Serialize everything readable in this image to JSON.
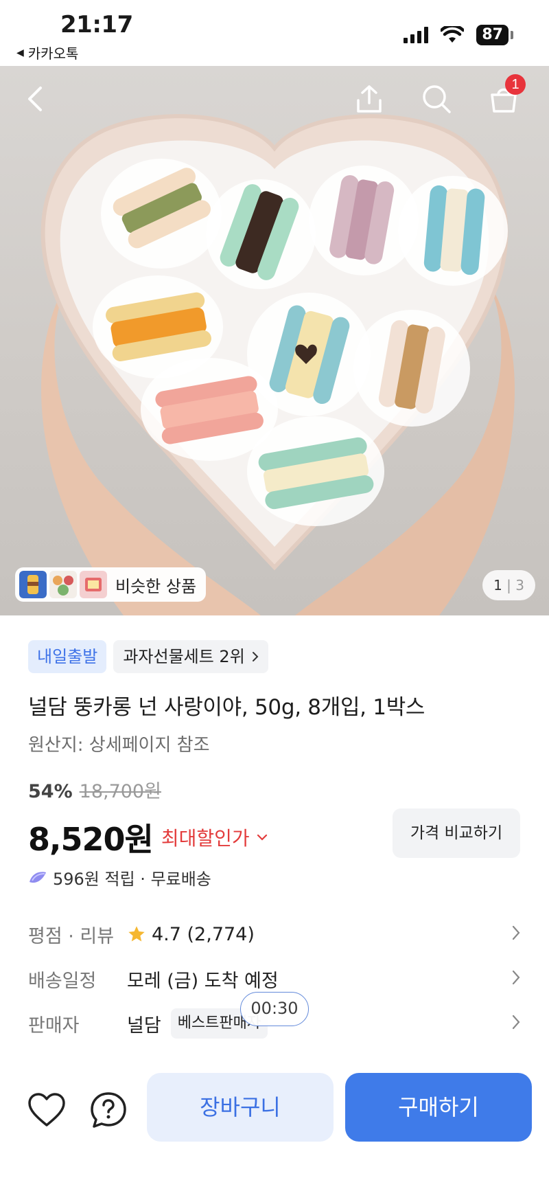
{
  "status_bar": {
    "time": "21:17",
    "back_app": "카카오톡",
    "battery": "87"
  },
  "hero": {
    "cart_count": "1",
    "similar_label": "비슷한 상품",
    "page_current": "1",
    "page_separator": "|",
    "page_total": "3"
  },
  "product": {
    "delivery_badge": "내일출발",
    "rank_badge": "과자선물세트 2위",
    "title": "널담 뚱카롱 넌 사랑이야, 50g, 8개입, 1박스",
    "origin": "원산지: 상세페이지 참조",
    "discount_rate": "54%",
    "original_price": "18,700원",
    "price": "8,520원",
    "max_discount_label": "최대할인가",
    "compare_button": "가격 비교하기",
    "points_text": "596원 적립 · 무료배송"
  },
  "details": {
    "rating_label": "평점 · 리뷰",
    "rating_value": "4.7 (2,774)",
    "delivery_label": "배송일정",
    "delivery_value": "모레 (금) 도착 예정",
    "seller_label": "판매자",
    "seller_value": "널담",
    "seller_tag": "베스트판매자"
  },
  "timer": "00:30",
  "bottom": {
    "cart_button": "장바구니",
    "buy_button": "구매하기"
  },
  "colors": {
    "accent_blue": "#3f7be9",
    "discount_red": "#e33b3b",
    "badge_red": "#e8343c"
  }
}
